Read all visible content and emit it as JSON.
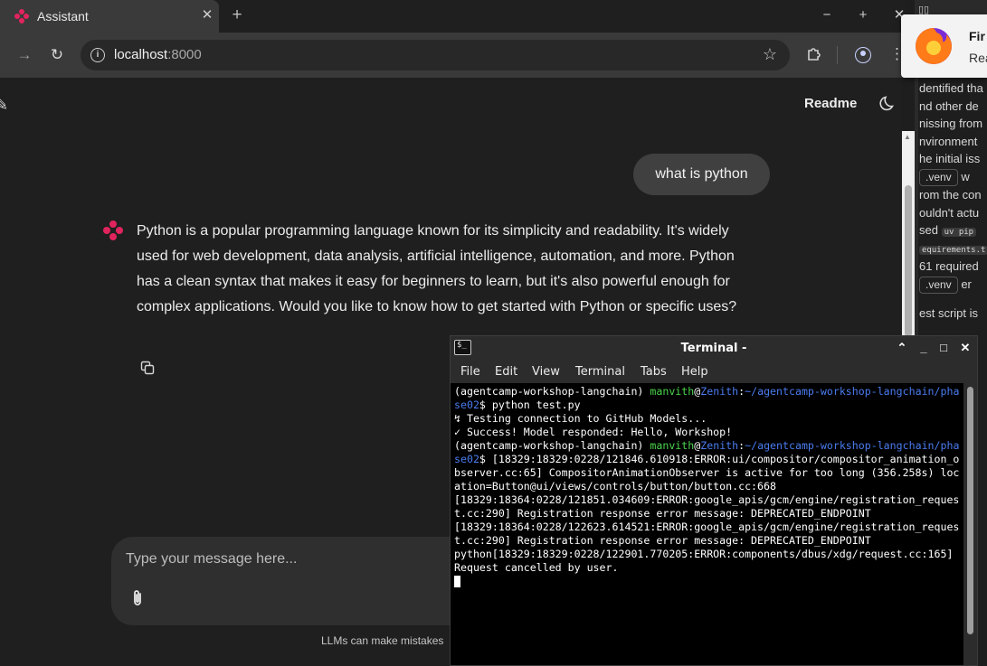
{
  "browser": {
    "tab_title": "Assistant",
    "tab_close": "✕",
    "new_tab": "+",
    "url_host": "localhost",
    "url_port": ":8000",
    "window_minimize": "−",
    "window_maximize": "+",
    "window_close": "✕"
  },
  "app": {
    "readme_label": "Readme",
    "user_message": "what is python",
    "assistant_message": "Python is a popular programming language known for its simplicity and readability. It's widely used for web development, data analysis, artificial intelligence, automation, and more. Python has a clean syntax that makes it easy for beginners to learn, but it's also powerful enough for complex applications. Would you like to know how to get started with Python or specific uses?",
    "input_placeholder": "Type your message here...",
    "disclaimer": "LLMs can make mistakes",
    "accent_color": "#e0245e"
  },
  "side_panel": {
    "notification_title": "Fir",
    "notification_body": "Rea",
    "lines": [
      "dentified tha",
      "nd other de",
      "nissing from",
      "nvironment",
      "he initial iss"
    ],
    "chip_venv": ".venv",
    "after_chip": "w",
    "lines2": [
      "rom the con",
      "ouldn't actu"
    ],
    "sed_prefix": "sed",
    "uv_pip": "uv pip",
    "requirements": "equirements.t",
    "required": "61 required",
    "chip_venv2": ".venv",
    "after_chip2": "er",
    "test_script": "est script is"
  },
  "terminal": {
    "title": "Terminal -",
    "menu": [
      "File",
      "Edit",
      "View",
      "Terminal",
      "Tabs",
      "Help"
    ],
    "env": "(agentcamp-workshop-langchain)",
    "user": "manvith",
    "at": "@",
    "host": "Zenith",
    "path_1a": "~/agentcamp-workshop-langchain/pha",
    "path_1b": "se02",
    "cmd_1": "$ python test.py",
    "out_1": "↯ Testing connection to GitHub Models...",
    "out_2": "✓ Success! Model responded: Hello, Workshop!",
    "cmd_2_start": "$ [18329:18329:0228/121846.610918:ERROR:ui/compositor/compositor_animation_o",
    "err_lines": [
      "bserver.cc:65] CompositorAnimationObserver is active for too long (356.258s) loc",
      "ation=Button@ui/views/controls/button/button.cc:668",
      "[18329:18364:0228/121851.034609:ERROR:google_apis/gcm/engine/registration_reques",
      "t.cc:290] Registration response error message: DEPRECATED_ENDPOINT",
      "[18329:18364:0228/122623.614521:ERROR:google_apis/gcm/engine/registration_reques",
      "t.cc:290] Registration response error message: DEPRECATED_ENDPOINT",
      "python[18329:18329:0228/122901.770205:ERROR:components/dbus/xdg/request.cc:165]",
      "Request cancelled by user."
    ]
  }
}
